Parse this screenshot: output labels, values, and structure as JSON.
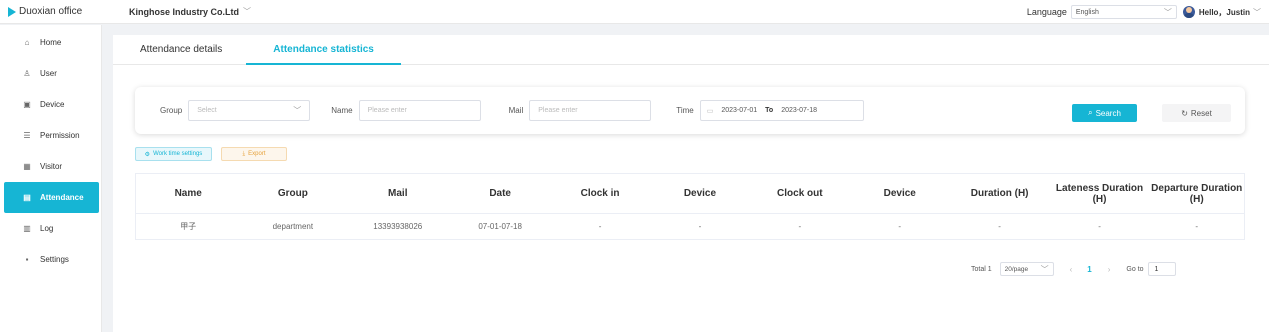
{
  "app": {
    "logo_text": "Duoxian office",
    "company": "Kinghose Industry Co.Ltd",
    "language_label": "Language",
    "language_value": "English",
    "greeting": "Hello，Justin",
    "accent_color": "#16b5d4"
  },
  "sidebar": {
    "items": [
      {
        "label": "Home",
        "icon": "home-icon"
      },
      {
        "label": "User",
        "icon": "user-icon"
      },
      {
        "label": "Device",
        "icon": "device-icon"
      },
      {
        "label": "Permission",
        "icon": "permission-icon"
      },
      {
        "label": "Visitor",
        "icon": "visitor-icon"
      },
      {
        "label": "Attendance",
        "icon": "attendance-icon",
        "active": true
      },
      {
        "label": "Log",
        "icon": "log-icon"
      },
      {
        "label": "Settings",
        "icon": "settings-icon"
      }
    ]
  },
  "tabs": [
    {
      "label": "Attendance details"
    },
    {
      "label": "Attendance statistics",
      "active": true
    }
  ],
  "filters": {
    "group_label": "Group",
    "group_placeholder": "Select",
    "name_label": "Name",
    "name_placeholder": "Please enter",
    "mail_label": "Mail",
    "mail_placeholder": "Please enter",
    "time_label": "Time",
    "date_from": "2023-07-01",
    "date_to_label": "To",
    "date_to": "2023-07-18",
    "search_label": "Search",
    "reset_label": "Reset"
  },
  "actions": {
    "work_time_label": "Work time settings",
    "export_label": "Export"
  },
  "table": {
    "columns": [
      "Name",
      "Group",
      "Mail",
      "Date",
      "Clock in",
      "Device",
      "Clock out",
      "Device",
      "Duration (H)",
      "Lateness Duration (H)",
      "Departure Duration (H)"
    ],
    "rows": [
      [
        "甲子",
        "department",
        "13393938026",
        "07-01-07-18",
        "-",
        "-",
        "-",
        "-",
        "-",
        "-",
        "-"
      ]
    ]
  },
  "pagination": {
    "total_text": "Total 1",
    "page_size": "20/page",
    "current_page": "1",
    "goto_label": "Go to",
    "goto_value": "1"
  }
}
